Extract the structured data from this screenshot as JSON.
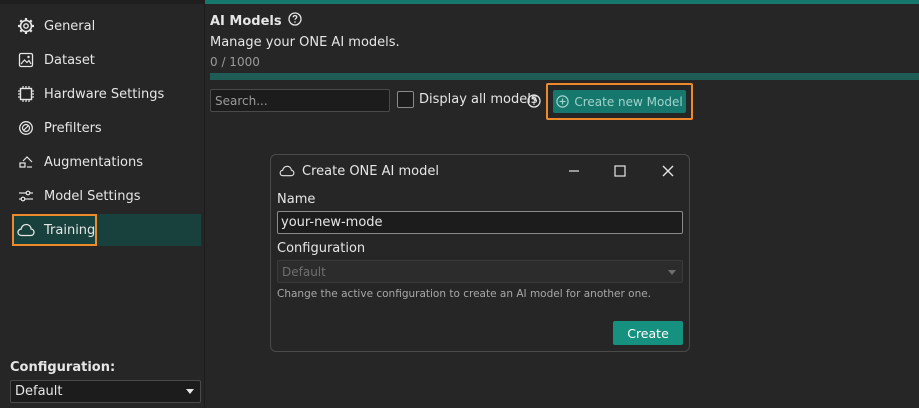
{
  "sidebar": {
    "items": [
      {
        "label": "General",
        "icon": "gear-icon"
      },
      {
        "label": "Dataset",
        "icon": "image-icon"
      },
      {
        "label": "Hardware Settings",
        "icon": "chip-icon"
      },
      {
        "label": "Prefilters",
        "icon": "filter-icon"
      },
      {
        "label": "Augmentations",
        "icon": "augment-icon"
      },
      {
        "label": "Model Settings",
        "icon": "sliders-icon"
      },
      {
        "label": "Training",
        "icon": "cloud-icon",
        "active": true
      }
    ],
    "config_label": "Configuration:",
    "config_value": "Default"
  },
  "main": {
    "title": "AI Models",
    "subtitle": "Manage your ONE AI models.",
    "count": "0 / 1000",
    "progress": 0,
    "search_placeholder": "Search...",
    "display_all_label": "Display all models",
    "display_all_checked": false,
    "create_button": "Create new Model"
  },
  "dialog": {
    "title": "Create ONE AI model",
    "name_label": "Name",
    "name_value": "your-new-mode",
    "config_label": "Configuration",
    "config_value": "Default",
    "hint": "Change the active configuration to create an AI model for another one.",
    "create_button": "Create"
  },
  "colors": {
    "accent": "#16776d",
    "highlight": "#ef8a2c",
    "active_bg": "#18403c"
  }
}
